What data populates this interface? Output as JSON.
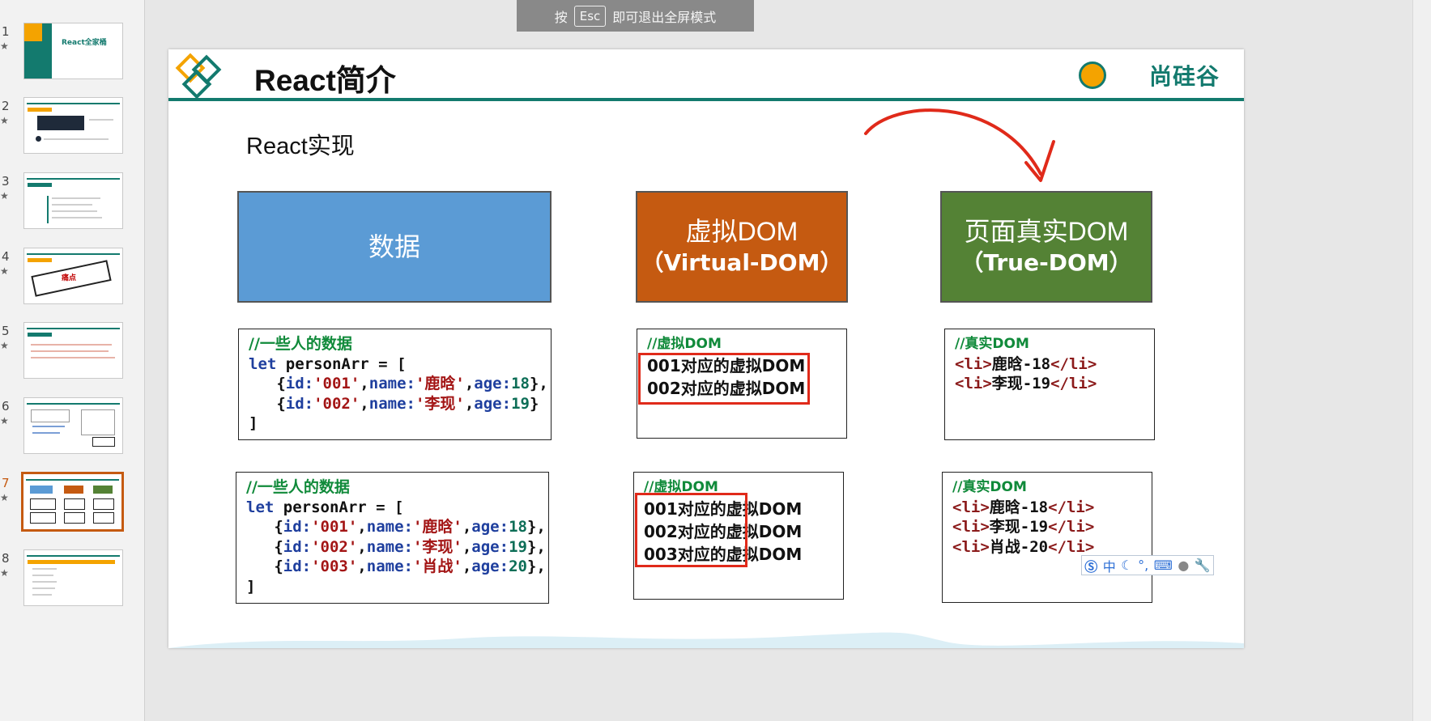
{
  "fullscreen_hint": {
    "prefix": "按",
    "key": "Esc",
    "suffix": "即可退出全屏模式"
  },
  "thumbnails": [
    {
      "num": "1",
      "star": "★",
      "text": "React全家桶"
    },
    {
      "num": "2",
      "star": "★"
    },
    {
      "num": "3",
      "star": "★"
    },
    {
      "num": "4",
      "star": "★",
      "text": "痛点"
    },
    {
      "num": "5",
      "star": "★"
    },
    {
      "num": "6",
      "star": "★"
    },
    {
      "num": "7",
      "star": "★",
      "active": true
    },
    {
      "num": "8",
      "star": "★"
    }
  ],
  "slide": {
    "title": "React简介",
    "logo": "尚硅谷",
    "subtitle": "React实现",
    "headers": {
      "data": {
        "label": "数据",
        "color": "#5b9bd5"
      },
      "virtual": {
        "line1": "虚拟DOM",
        "line2": "（Virtual-DOM）",
        "color": "#c55a11"
      },
      "real": {
        "line1": "页面真实DOM",
        "line2": "（True-DOM）",
        "color": "#548235"
      }
    },
    "row1": {
      "data_comment": "//一些人的数据",
      "data_decl": [
        "let",
        " personArr = ["
      ],
      "data_items": [
        {
          "id": "'001'",
          "name": "'鹿晗'",
          "age": "18",
          "trail": "},"
        },
        {
          "id": "'002'",
          "name": "'李现'",
          "age": "19",
          "trail": "}"
        }
      ],
      "data_close": "]",
      "vdom_comment": "//虚拟DOM",
      "vdom_items": [
        "001对应的虚拟DOM",
        "002对应的虚拟DOM"
      ],
      "real_comment": "//真实DOM",
      "real_items": [
        "鹿晗-18",
        "李现-19"
      ]
    },
    "row2": {
      "data_comment": "//一些人的数据",
      "data_decl": [
        "let",
        " personArr = ["
      ],
      "data_items": [
        {
          "id": "'001'",
          "name": "'鹿晗'",
          "age": "18",
          "trail": "},"
        },
        {
          "id": "'002'",
          "name": "'李现'",
          "age": "19",
          "trail": "},"
        },
        {
          "id": "'003'",
          "name": "'肖战'",
          "age": "20",
          "trail": "},"
        }
      ],
      "data_close": "]",
      "vdom_comment": "//虚拟DOM",
      "vdom_items": [
        "001对应的虚拟DOM",
        "002对应的虚拟DOM",
        "003对应的虚拟DOM"
      ],
      "real_comment": "//真实DOM",
      "real_items": [
        "鹿晗-18",
        "李现-19",
        "肖战-20"
      ]
    },
    "li_open": "<li>",
    "li_close": "</li>",
    "accent_colors": {
      "teal": "#137a6e",
      "annotation_red": "#e02a1a"
    }
  },
  "ime_toolbar": {
    "mode": "中",
    "icons": [
      "sogou-logo-icon",
      "moon-icon",
      "punctuation-icon",
      "keyboard-icon",
      "user-icon",
      "wrench-icon"
    ]
  }
}
